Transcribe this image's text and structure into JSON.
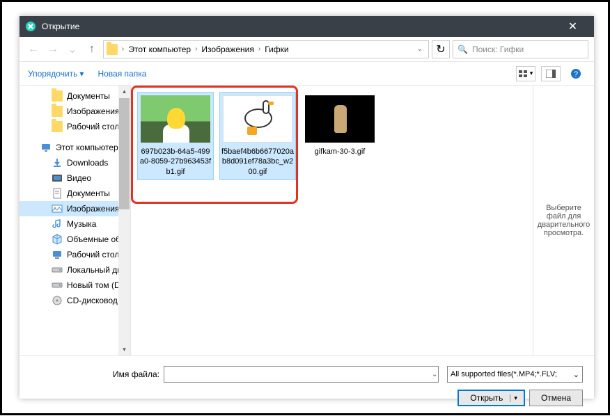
{
  "window": {
    "title": "Открытие",
    "close_icon": "✕"
  },
  "nav": {
    "back_icon": "←",
    "fwd_icon": "→",
    "up_icon": "↑",
    "refresh_icon": "↻",
    "dropdown_icon": "⌄"
  },
  "breadcrumb": {
    "sep": "›",
    "seg1": "Этот компьютер",
    "seg2": "Изображения",
    "seg3": "Гифки"
  },
  "search": {
    "icon": "🔍",
    "placeholder": "Поиск: Гифки"
  },
  "toolbar": {
    "organize": "Упорядочить",
    "dd": "▾",
    "new_folder": "Новая папка",
    "view_dd": "▾",
    "help_icon": "?"
  },
  "sidebar": {
    "items": [
      {
        "label": "Документы",
        "icon": "folder"
      },
      {
        "label": "Изображения",
        "icon": "folder"
      },
      {
        "label": "Рабочий стол",
        "icon": "folder"
      },
      {
        "label": "Этот компьютер",
        "icon": "pc"
      },
      {
        "label": "Downloads",
        "icon": "downloads"
      },
      {
        "label": "Видео",
        "icon": "video"
      },
      {
        "label": "Документы",
        "icon": "docs"
      },
      {
        "label": "Изображения",
        "icon": "images"
      },
      {
        "label": "Музыка",
        "icon": "music"
      },
      {
        "label": "Объемные объ",
        "icon": "3d"
      },
      {
        "label": "Рабочий стол",
        "icon": "desktop"
      },
      {
        "label": "Локальный дис",
        "icon": "drive"
      },
      {
        "label": "Новый том (D:)",
        "icon": "drive"
      },
      {
        "label": "CD-дисковод (F",
        "icon": "cd"
      }
    ],
    "scroll_up": "▴",
    "scroll_down": "▾"
  },
  "files": [
    {
      "name": "697b023b-64a5-499a0-8059-27b963453fb1.gif",
      "thumb": "homer",
      "selected": true
    },
    {
      "name": "f5baef4b6b6677020ab8d091ef78a3bc_w200.gif",
      "thumb": "goose",
      "selected": true
    },
    {
      "name": "gifkam-30-3.gif",
      "thumb": "baby",
      "selected": false
    }
  ],
  "preview": {
    "text": "Выберите файл для дварительного просмотра."
  },
  "footer": {
    "filename_label": "Имя файла:",
    "filename_value": "",
    "filter": "All supported files(*.MP4;*.FLV;",
    "filter_dd": "⌄",
    "open": "Открыть",
    "open_dd": "▾",
    "cancel": "Отмена"
  }
}
